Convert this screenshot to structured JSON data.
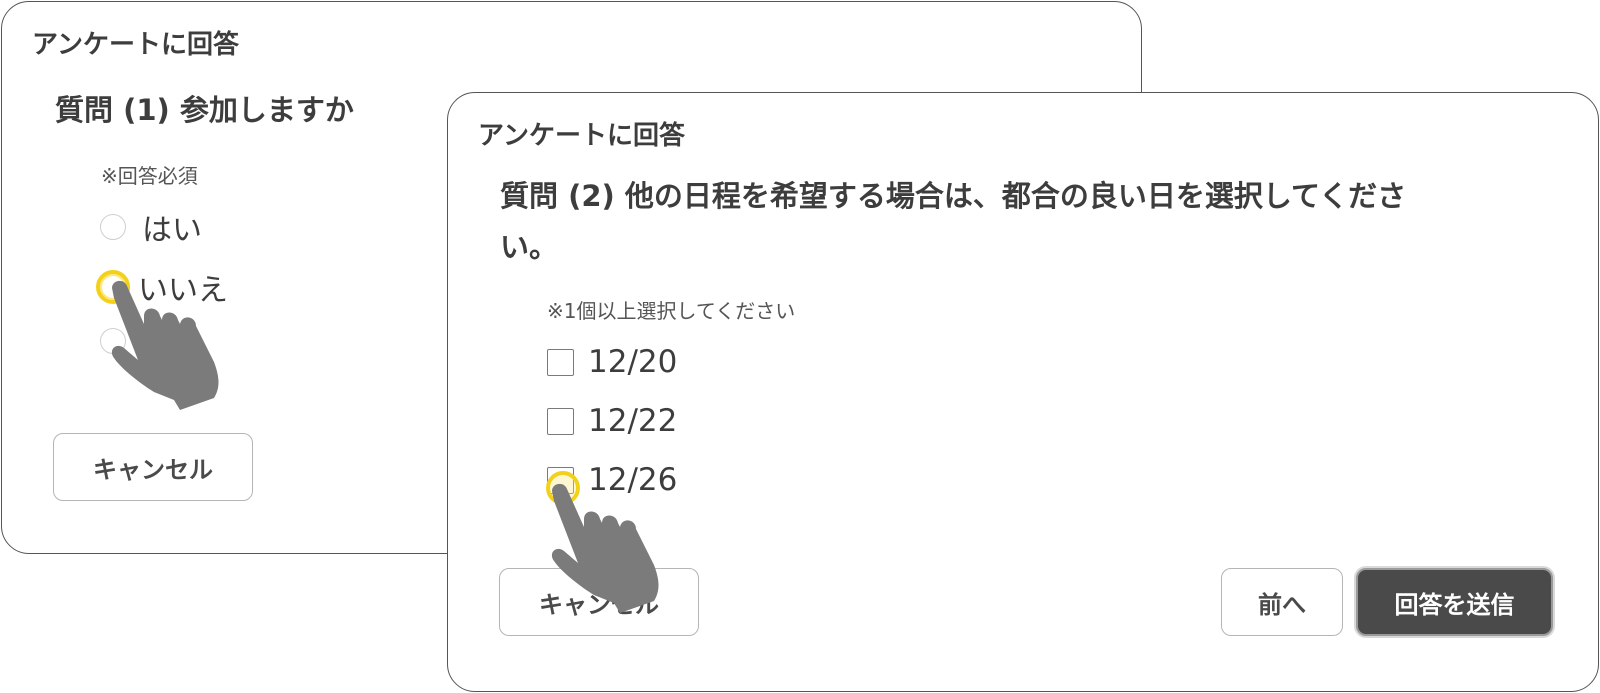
{
  "back_card": {
    "title": "アンケートに回答",
    "question": "質問 (1) 参加しますか",
    "note": "※回答必須",
    "options": [
      {
        "label": "はい",
        "selected": false
      },
      {
        "label": "いいえ",
        "selected": true
      }
    ],
    "cancel_label": "キャンセル"
  },
  "front_card": {
    "title": "アンケートに回答",
    "question_line1": "質問 (2) 他の日程を希望する場合は、都合の良い日を選択してくださ",
    "question_line2": "い。",
    "note": "※1個以上選択してください",
    "options": [
      {
        "label": "12/20",
        "checked": false
      },
      {
        "label": "12/22",
        "checked": false
      },
      {
        "label": "12/26",
        "checked": false
      }
    ],
    "cancel_label": "キャンセル",
    "prev_label": "前へ",
    "submit_label": "回答を送信"
  },
  "colors": {
    "highlight": "#f3d11a",
    "hand": "#7b7b7b",
    "primary_button": "#4a4a4a"
  },
  "icons": [
    "pointing-hand-icon"
  ]
}
